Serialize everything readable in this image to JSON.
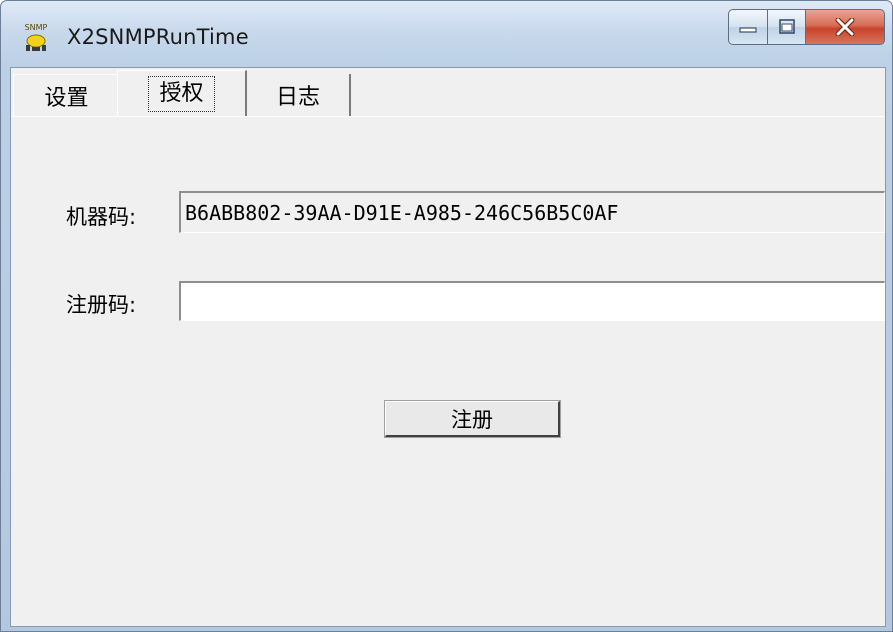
{
  "window": {
    "title": "X2SNMPRunTime",
    "icon": "snmp-app-icon",
    "icon_text": "SNMP"
  },
  "tabs": [
    {
      "label": "设置",
      "selected": false
    },
    {
      "label": "授权",
      "selected": true
    },
    {
      "label": "日志",
      "selected": false
    }
  ],
  "form": {
    "machine_code_label": "机器码:",
    "machine_code_value": "B6ABB802-39AA-D91E-A985-246C56B5C0AF",
    "register_code_label": "注册码:",
    "register_code_value": "",
    "register_button_label": "注册"
  },
  "colors": {
    "titlebar": "#c9d9ec",
    "close_button": "#c7432a",
    "client_background": "#f0f0f0"
  }
}
